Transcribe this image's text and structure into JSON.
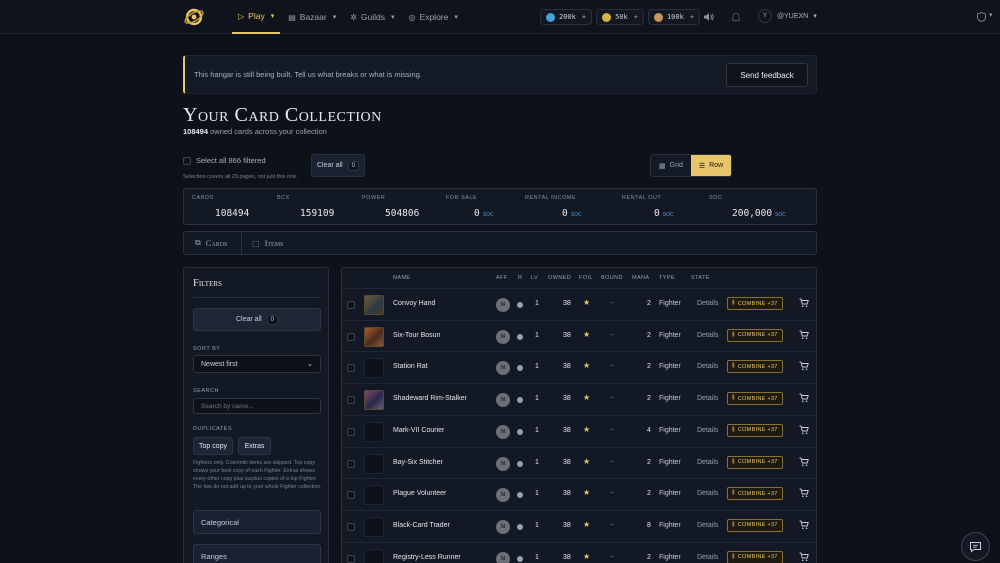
{
  "nav": {
    "items": [
      {
        "label": "Play",
        "icon": "play-icon"
      },
      {
        "label": "Bazaar",
        "icon": "store-icon"
      },
      {
        "label": "Guilds",
        "icon": "guild-icon"
      },
      {
        "label": "Explore",
        "icon": "compass-icon"
      }
    ],
    "active": "Play"
  },
  "wallets": [
    {
      "value": "200k",
      "plus": "+",
      "color": "#4aa0d8"
    },
    {
      "value": "50k",
      "plus": "+",
      "color": "#d8b24a"
    },
    {
      "value": "100k",
      "plus": "+",
      "color": "#c8955a"
    }
  ],
  "user": {
    "initial": "Y",
    "handle": "@YUEXN"
  },
  "banner": {
    "text": "This hangar is still being built. Tell us what breaks or what is missing.",
    "button": "Send feedback"
  },
  "page": {
    "title": "Your Card Collection",
    "owned_count": "108494",
    "owned_suffix": "owned cards across your collection"
  },
  "selection": {
    "select_all_label": "Select all 866 filtered",
    "note": "Selection covers all 29 pages, not just this one.",
    "clear_label": "Clear all",
    "clear_count": "0"
  },
  "view_toggle": {
    "grid": "Grid",
    "row": "Row",
    "active": "Row"
  },
  "stats": [
    {
      "label": "CARDS",
      "value": "108494",
      "unit": ""
    },
    {
      "label": "BCX",
      "value": "159109",
      "unit": ""
    },
    {
      "label": "POWER",
      "value": "504806",
      "unit": ""
    },
    {
      "label": "FOR SALE",
      "value": "0",
      "unit": "SOC"
    },
    {
      "label": "RENTAL INCOME",
      "value": "0",
      "unit": "SOC"
    },
    {
      "label": "RENTAL OUT",
      "value": "0",
      "unit": "SOC"
    },
    {
      "label": "SOC",
      "value": "200,000",
      "unit": "SOC"
    }
  ],
  "tabs": {
    "cards": "Cards",
    "items": "Items",
    "active": "Cards"
  },
  "filters": {
    "title": "Filters",
    "clear_label": "Clear all",
    "clear_count": "0",
    "sort_label": "SORT BY",
    "sort_value": "Newest first",
    "search_label": "SEARCH",
    "search_placeholder": "Search by name...",
    "duplicates_label": "DUPLICATES",
    "dup_top": "Top copy",
    "dup_extras": "Extras",
    "help": "Fighters only. Cosmetic items are skipped. Top copy shows your best copy of each Fighter. Extras shows every other copy plus surplus copies of a top Fighter. The two do not add up to your whole Fighter collection.",
    "section_categorical": "Categorical",
    "section_ranges": "Ranges"
  },
  "table": {
    "headers": {
      "name": "NAME",
      "aff": "AFF",
      "r": "R",
      "lv": "LV",
      "owned": "OWNED",
      "foil": "FOIL",
      "bound": "BOUND",
      "mana": "MANA",
      "type": "TYPE",
      "state": "STATE"
    },
    "rows": [
      {
        "name": "Convoy Hand",
        "aff": "N",
        "lv": "1",
        "owned": "38",
        "bound": "–",
        "mana": "2",
        "type": "Fighter",
        "details": "Details",
        "combine": "COMBINE +37",
        "art": "art1"
      },
      {
        "name": "Six-Tour Bosun",
        "aff": "N",
        "lv": "1",
        "owned": "38",
        "bound": "–",
        "mana": "2",
        "type": "Fighter",
        "details": "Details",
        "combine": "COMBINE +37",
        "art": "art2"
      },
      {
        "name": "Station Rat",
        "aff": "N",
        "lv": "1",
        "owned": "38",
        "bound": "–",
        "mana": "2",
        "type": "Fighter",
        "details": "Details",
        "combine": "COMBINE +37",
        "art": ""
      },
      {
        "name": "Shadeward Rim-Stalker",
        "aff": "N",
        "lv": "1",
        "owned": "38",
        "bound": "–",
        "mana": "2",
        "type": "Fighter",
        "details": "Details",
        "combine": "COMBINE +37",
        "art": "art3"
      },
      {
        "name": "Mark-VII Courier",
        "aff": "N",
        "lv": "1",
        "owned": "38",
        "bound": "–",
        "mana": "4",
        "type": "Fighter",
        "details": "Details",
        "combine": "COMBINE +37",
        "art": ""
      },
      {
        "name": "Bay-Six Stitcher",
        "aff": "N",
        "lv": "1",
        "owned": "38",
        "bound": "–",
        "mana": "2",
        "type": "Fighter",
        "details": "Details",
        "combine": "COMBINE +37",
        "art": ""
      },
      {
        "name": "Plague Volunteer",
        "aff": "N",
        "lv": "1",
        "owned": "38",
        "bound": "–",
        "mana": "2",
        "type": "Fighter",
        "details": "Details",
        "combine": "COMBINE +37",
        "art": ""
      },
      {
        "name": "Black-Card Trader",
        "aff": "N",
        "lv": "1",
        "owned": "38",
        "bound": "–",
        "mana": "8",
        "type": "Fighter",
        "details": "Details",
        "combine": "COMBINE +37",
        "art": ""
      },
      {
        "name": "Registry-Less Runner",
        "aff": "N",
        "lv": "1",
        "owned": "38",
        "bound": "–",
        "mana": "2",
        "type": "Fighter",
        "details": "Details",
        "combine": "COMBINE +37",
        "art": ""
      }
    ]
  }
}
